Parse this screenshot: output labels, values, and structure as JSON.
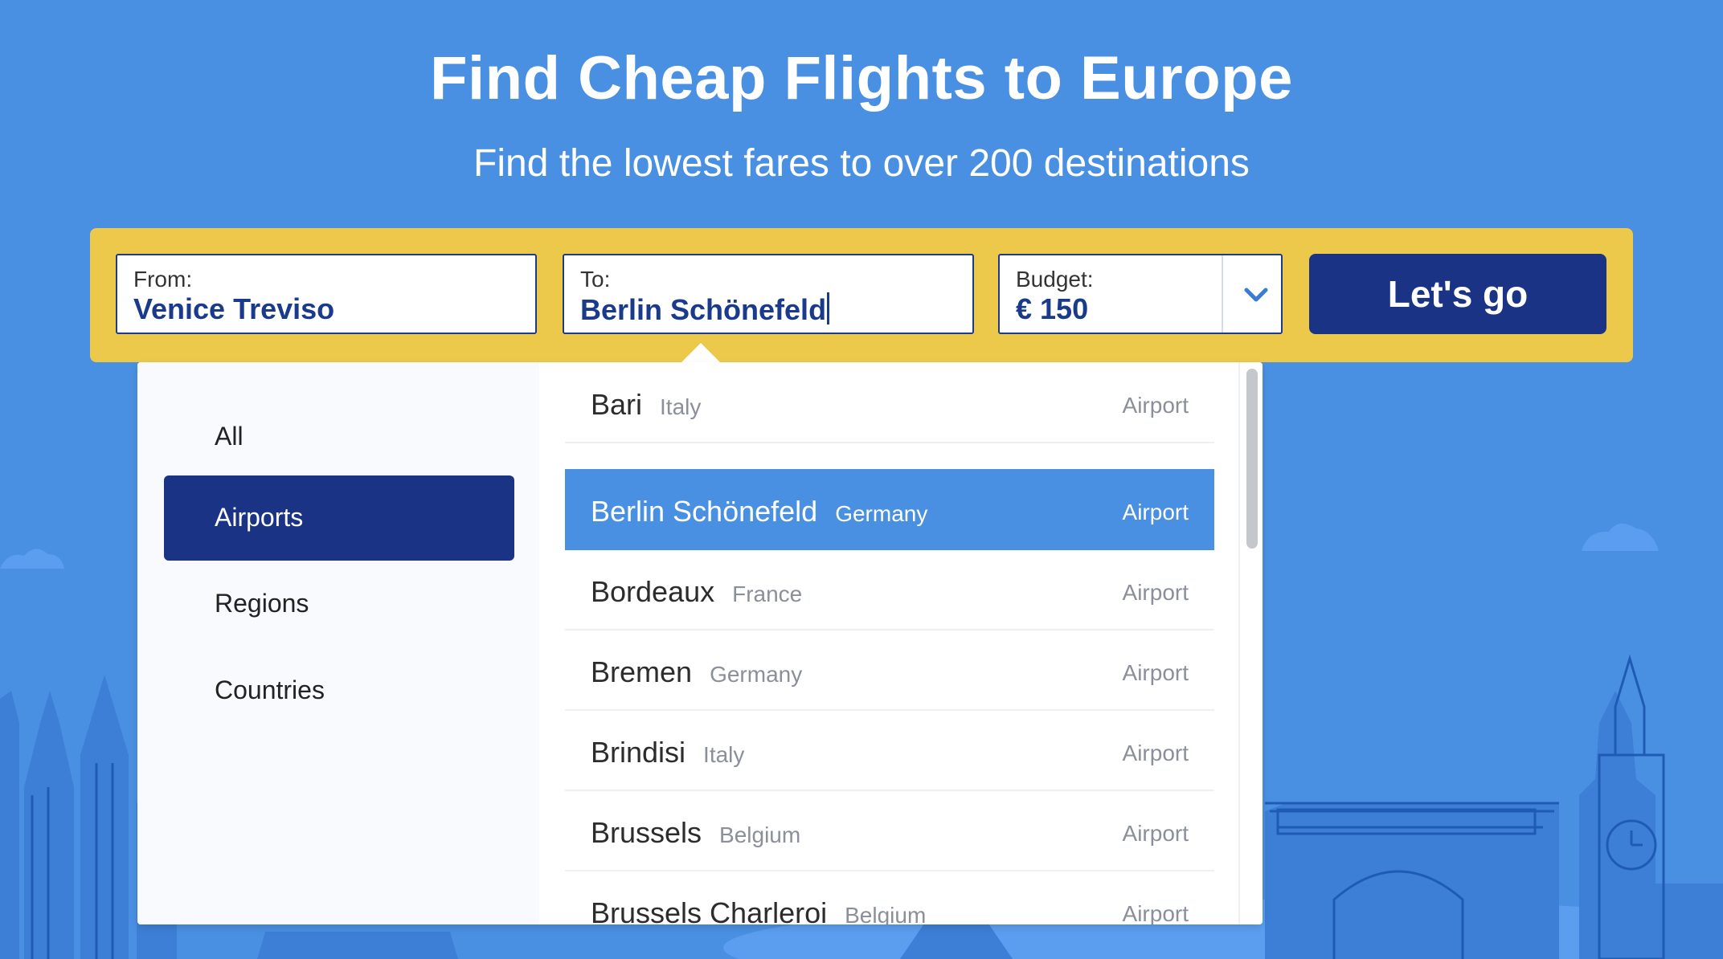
{
  "header": {
    "title": "Find Cheap Flights to Europe",
    "subtitle": "Find the lowest fares to over 200 destinations"
  },
  "search": {
    "from_label": "From:",
    "from_value": "Venice Treviso",
    "to_label": "To:",
    "to_value": "Berlin Schönefeld",
    "budget_label": "Budget:",
    "budget_value": "€ 150",
    "submit_label": "Let's go"
  },
  "dropdown": {
    "categories": [
      {
        "label": "All"
      },
      {
        "label": "Airports"
      },
      {
        "label": "Regions"
      },
      {
        "label": "Countries"
      }
    ],
    "active_category": "Airports",
    "results": [
      {
        "city": "Bari",
        "country": "Italy",
        "type": "Airport"
      },
      {
        "city": "Berlin Schönefeld",
        "country": "Germany",
        "type": "Airport"
      },
      {
        "city": "Bordeaux",
        "country": "France",
        "type": "Airport"
      },
      {
        "city": "Bremen",
        "country": "Germany",
        "type": "Airport"
      },
      {
        "city": "Brindisi",
        "country": "Italy",
        "type": "Airport"
      },
      {
        "city": "Brussels",
        "country": "Belgium",
        "type": "Airport"
      },
      {
        "city": "Brussels Charleroi",
        "country": "Belgium",
        "type": "Airport"
      }
    ],
    "highlighted_result": "Berlin Schönefeld"
  },
  "colors": {
    "background": "#4a90e2",
    "search_bar": "#ecc94b",
    "primary": "#1a3385",
    "highlight": "#4a90e2"
  },
  "icons": {
    "budget_dropdown": "chevron-down-icon"
  }
}
